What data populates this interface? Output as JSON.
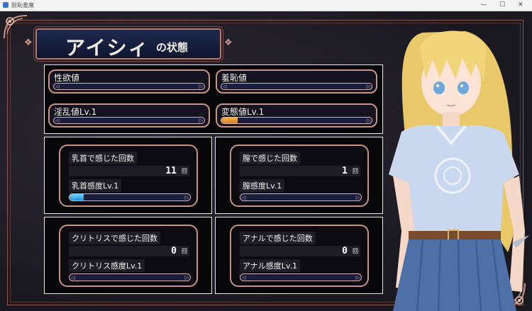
{
  "window": {
    "title": "耐恥羞魔"
  },
  "banner": {
    "name": "アイシィ",
    "suffix": "の状態"
  },
  "gauges": [
    {
      "label": "性欲値",
      "fill": 0
    },
    {
      "label": "羞恥値",
      "fill": 0
    },
    {
      "label": "淫乱値Lv.1",
      "fill": 0
    },
    {
      "label": "変態値Lv.1",
      "fill": 0.11
    }
  ],
  "cards": [
    {
      "count_label": "乳首で感じた回数",
      "count": "11",
      "unit": "回",
      "level_label": "乳首感度Lv.1",
      "level_fill": 0.12
    },
    {
      "count_label": "膣で感じた回数",
      "count": "1",
      "unit": "回",
      "level_label": "膣感度Lv.1",
      "level_fill": 0
    },
    {
      "count_label": "クリトリスで感じた回数",
      "count": "0",
      "unit": "回",
      "level_label": "クリトリス感度Lv.1",
      "level_fill": 0
    },
    {
      "count_label": "アナルで感じた回数",
      "count": "0",
      "unit": "回",
      "level_label": "アナル感度Lv.1",
      "level_fill": 0
    }
  ],
  "colors": {
    "frame": "#c89484",
    "gauge_fill": "#e8912c",
    "level_fill": "#3aa9e8",
    "panel_bg": "#07070a"
  }
}
